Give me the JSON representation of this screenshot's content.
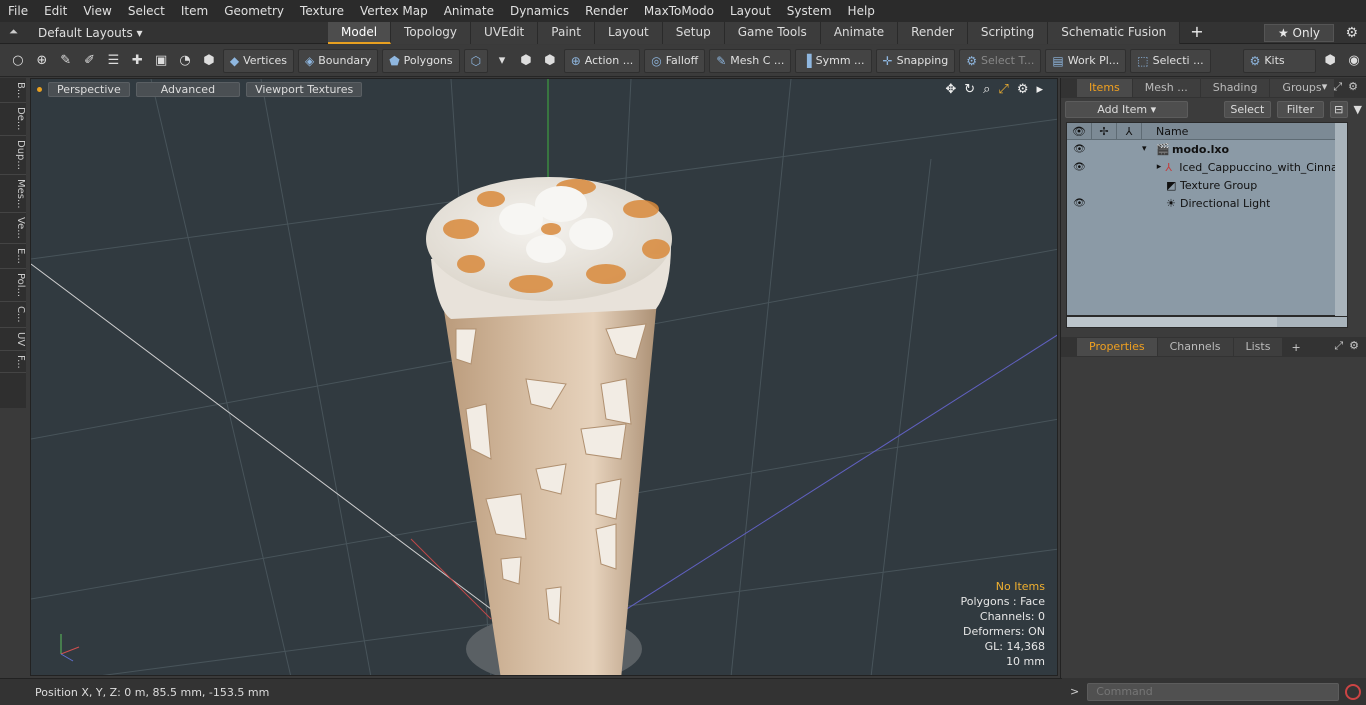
{
  "menu": [
    "File",
    "Edit",
    "View",
    "Select",
    "Item",
    "Geometry",
    "Texture",
    "Vertex Map",
    "Animate",
    "Dynamics",
    "Render",
    "MaxToModo",
    "Layout",
    "System",
    "Help"
  ],
  "layout": {
    "default_layouts": "Default Layouts ▾",
    "tabs": [
      "Model",
      "Topology",
      "UVEdit",
      "Paint",
      "Layout",
      "Setup",
      "Game Tools",
      "Animate",
      "Render",
      "Scripting",
      "Schematic Fusion"
    ],
    "active_tab": "Model",
    "only_label": "★ Only"
  },
  "toolbar": {
    "vertices": "Vertices",
    "boundary": "Boundary",
    "polygons": "Polygons",
    "action": "Action ...",
    "falloff": "Falloff",
    "mesh": "Mesh C ...",
    "symmetry": "Symm ...",
    "snapping": "Snapping",
    "select_t": "Select T...",
    "work_plane": "Work Pl...",
    "selection": "Selecti ...",
    "kits": "Kits"
  },
  "left_strip": [
    "B...",
    "De...",
    "Dup...",
    "Mes...",
    "Ve...",
    "E...",
    "Pol...",
    "C...",
    "UV",
    "F..."
  ],
  "viewport": {
    "perspective": "Perspective",
    "advanced": "Advanced",
    "viewport_textures": "Viewport Textures",
    "stats": {
      "no_items": "No Items",
      "polygons": "Polygons : Face",
      "channels": "Channels: 0",
      "deformers": "Deformers: ON",
      "gl": "GL: 14,368",
      "scale": "10 mm"
    }
  },
  "items_panel": {
    "tabs": [
      "Items",
      "Mesh ...",
      "Shading",
      "Groups"
    ],
    "active_tab": "Items",
    "add_item": "Add Item",
    "select": "Select",
    "filter": "Filter",
    "name_col": "Name",
    "tree": [
      {
        "name": "modo.lxo",
        "bold": true
      },
      {
        "name": "Iced_Cappuccino_with_Cinna...",
        "bold": false
      },
      {
        "name": "Texture Group",
        "bold": false
      },
      {
        "name": "Directional Light",
        "bold": false
      }
    ]
  },
  "props_panel": {
    "tabs": [
      "Properties",
      "Channels",
      "Lists"
    ],
    "active_tab": "Properties"
  },
  "status": {
    "position": "Position X, Y, Z:   0 m, 85.5 mm, -153.5 mm"
  },
  "command": {
    "placeholder": "Command"
  },
  "colors": {
    "accent": "#e8a020",
    "viewport_bg": "#313a40",
    "tree_bg": "#8b9aa6"
  }
}
